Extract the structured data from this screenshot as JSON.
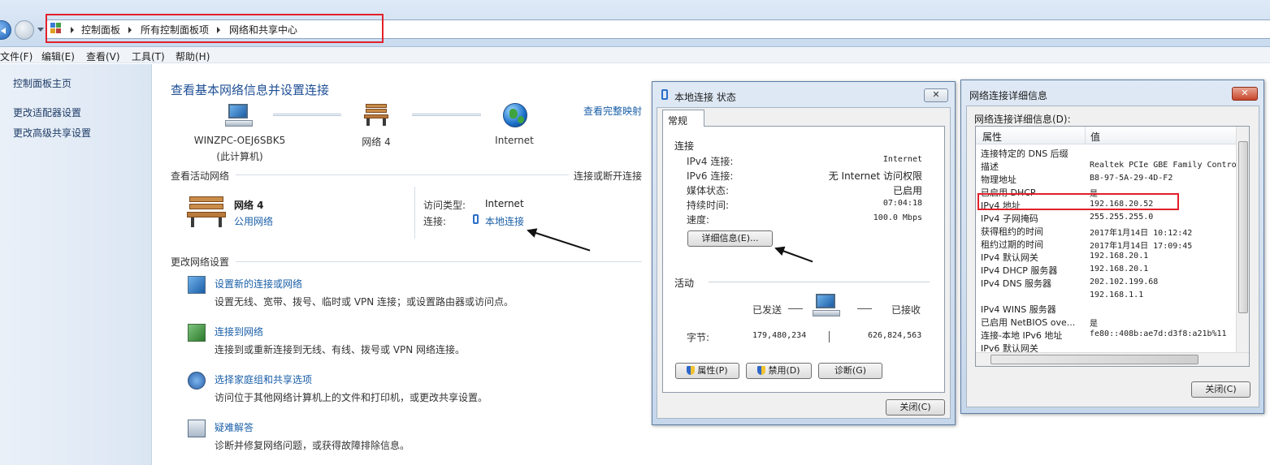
{
  "breadcrumb": [
    "控制面板",
    "所有控制面板项",
    "网络和共享中心"
  ],
  "menu": [
    "文件(F)",
    "编辑(E)",
    "查看(V)",
    "工具(T)",
    "帮助(H)"
  ],
  "left_pane": {
    "home": "控制面板主页",
    "links": [
      "更改适配器设置",
      "更改高级共享设置"
    ]
  },
  "main": {
    "title": "查看基本网络信息并设置连接",
    "full_map": "查看完整映射",
    "nodes": {
      "pc_name": "WINZPC-OEJ6SBK5",
      "pc_sub": "(此计算机)",
      "network": "网络  4",
      "internet": "Internet"
    },
    "active_networks": {
      "heading": "查看活动网络",
      "connect_link": "连接或断开连接",
      "name": "网络  4",
      "type": "公用网络",
      "access_label": "访问类型:",
      "access_value": "Internet",
      "conn_label": "连接:",
      "conn_value": "本地连接"
    },
    "change_settings": {
      "heading": "更改网络设置",
      "tasks": [
        {
          "title": "设置新的连接或网络",
          "desc": "设置无线、宽带、拨号、临时或 VPN 连接；或设置路由器或访问点。",
          "icon": "new-connection-icon"
        },
        {
          "title": "连接到网络",
          "desc": "连接到或重新连接到无线、有线、拨号或 VPN 网络连接。",
          "icon": "connect-network-icon"
        },
        {
          "title": "选择家庭组和共享选项",
          "desc": "访问位于其他网络计算机上的文件和打印机，或更改共享设置。",
          "icon": "homegroup-icon"
        },
        {
          "title": "疑难解答",
          "desc": "诊断并修复网络问题，或获得故障排除信息。",
          "icon": "troubleshoot-icon"
        }
      ]
    }
  },
  "status_dialog": {
    "title": "本地连接 状态",
    "close_x": "✕",
    "tab": "常规",
    "connection_heading": "连接",
    "rows": [
      {
        "label": "IPv4 连接:",
        "value": "Internet"
      },
      {
        "label": "IPv6 连接:",
        "value": "无 Internet 访问权限"
      },
      {
        "label": "媒体状态:",
        "value": "已启用"
      },
      {
        "label": "持续时间:",
        "value": "07:04:18"
      },
      {
        "label": "速度:",
        "value": "100.0 Mbps"
      }
    ],
    "details_button": "详细信息(E)...",
    "activity_heading": "活动",
    "sent_label": "已发送",
    "received_label": "已接收",
    "bytes_label": "字节:",
    "bytes_sent": "179,480,234",
    "bytes_received": "626,824,563",
    "properties_button": "属性(P)",
    "disable_button": "禁用(D)",
    "diagnose_button": "诊断(G)",
    "close_button": "关闭(C)"
  },
  "details_dialog": {
    "title": "网络连接详细信息",
    "close_x": "✕",
    "label": "网络连接详细信息(D):",
    "col_property": "属性",
    "col_value": "值",
    "rows": [
      {
        "prop": "连接特定的 DNS 后缀",
        "val": ""
      },
      {
        "prop": "描述",
        "val": "Realtek PCIe GBE Family Contro"
      },
      {
        "prop": "物理地址",
        "val": "B8-97-5A-29-4D-F2"
      },
      {
        "prop": "已启用 DHCP",
        "val": "是"
      },
      {
        "prop": "IPv4 地址",
        "val": "192.168.20.52"
      },
      {
        "prop": "IPv4 子网掩码",
        "val": "255.255.255.0"
      },
      {
        "prop": "获得租约的时间",
        "val": "2017年1月14日 10:12:42"
      },
      {
        "prop": "租约过期的时间",
        "val": "2017年1月14日 17:09:45"
      },
      {
        "prop": "IPv4 默认网关",
        "val": "192.168.20.1"
      },
      {
        "prop": "IPv4 DHCP 服务器",
        "val": "192.168.20.1"
      },
      {
        "prop": "IPv4 DNS 服务器",
        "val": "202.102.199.68"
      },
      {
        "prop": "",
        "val": "192.168.1.1"
      },
      {
        "prop": "IPv4 WINS 服务器",
        "val": ""
      },
      {
        "prop": "已启用 NetBIOS ove...",
        "val": "是"
      },
      {
        "prop": "连接-本地 IPv6 地址",
        "val": "fe80::408b:ae7d:d3f8:a21b%11"
      },
      {
        "prop": "IPv6 默认网关",
        "val": ""
      }
    ],
    "close_button": "关闭(C)"
  },
  "colors": {
    "link": "#1a5fa8",
    "highlight": "#e2202a",
    "title_blue": "#1e4f96"
  }
}
